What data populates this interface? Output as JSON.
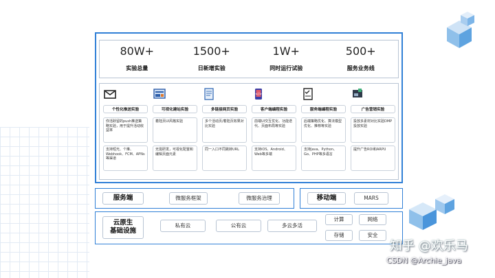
{
  "stats": [
    {
      "num": "80W+",
      "label": "实验总量"
    },
    {
      "num": "1500+",
      "label": "日新增实验"
    },
    {
      "num": "1W+",
      "label": "同时运行试验"
    },
    {
      "num": "500+",
      "label": "服务业务线"
    }
  ],
  "cards": [
    {
      "title": "个性化推送实验",
      "icon": "envelope-icon",
      "desc1": "你活跃留的push推送策略实验，用于提升活动收益率",
      "desc2": "支持短光、个推、Webhook、FCM、APNs等渠道"
    },
    {
      "title": "可视化建站实验",
      "icon": "site-builder-icon",
      "desc1": "着陆页UI风格实验",
      "desc2": "无需研发，可视化配置和编辑页面元素"
    },
    {
      "title": "多链接网页实验",
      "icon": "document-icon",
      "desc1": "多个活动页/着陆页效果对比实验",
      "desc2": "同一入口不同跳转URL"
    },
    {
      "title": "客户端编程实验",
      "icon": "mobile-code-icon",
      "desc1": "前端UI交互优化、功能迭代、页面布局等实验",
      "desc2": "支持iOS、Android、Web等多端"
    },
    {
      "title": "服务端编程实验",
      "icon": "checklist-icon",
      "desc1": "后端策略优化、算法模型优化、推荐等实验",
      "desc2": "支持Java、Python、Go、PHP等多语言"
    },
    {
      "title": "广告营销实验",
      "icon": "ad-icon",
      "desc1": "投放多素材对比实验DMP投放实验",
      "desc2": "提升广告ROI和ARPU"
    }
  ],
  "server": {
    "label": "服务端",
    "items": [
      "微服务框架",
      "微服务治理"
    ]
  },
  "mobile": {
    "label": "移动端",
    "items": [
      "MARS"
    ]
  },
  "cloud": {
    "label": "云原生\n基础设施",
    "items": [
      "私有云",
      "公有云",
      "多云多活"
    ],
    "grid": [
      "计算",
      "网络",
      "存储",
      "安全"
    ]
  },
  "watermark": {
    "line1": "知乎 @欢乐马",
    "line2": "CSDN @Archie_java"
  },
  "colors": {
    "accent": "#2f7fd6",
    "border": "#b8c4d3"
  }
}
